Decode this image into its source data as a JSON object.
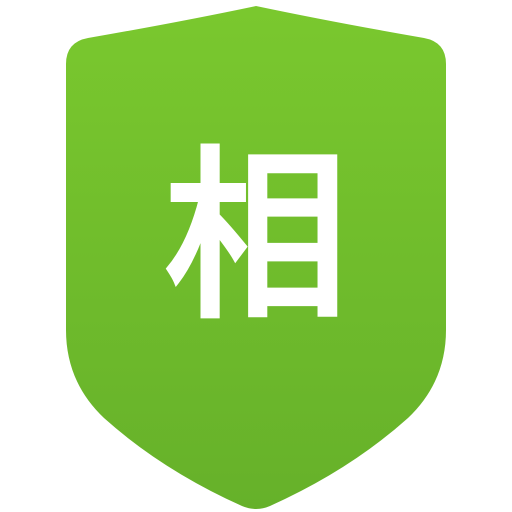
{
  "icon": {
    "name": "shield-icon",
    "glyph": "相",
    "colors": {
      "top": "#7AC82E",
      "bottom": "#66B12A",
      "glyph": "#FFFFFF",
      "background": "#FFFFFF"
    }
  }
}
